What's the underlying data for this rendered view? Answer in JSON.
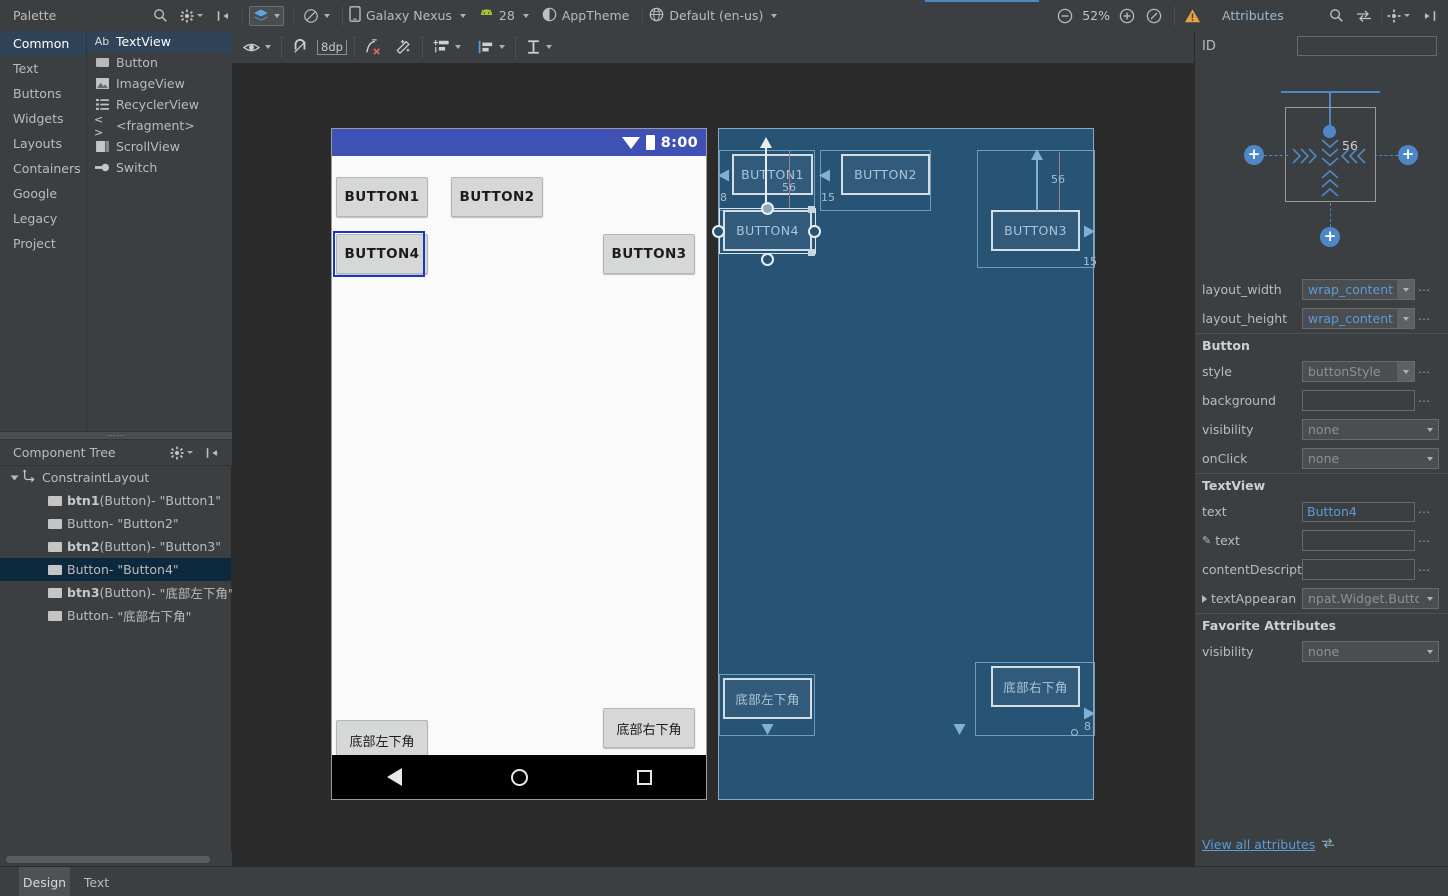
{
  "topbar": {
    "palette_title": "Palette",
    "search_icon": "search-icon",
    "gear_icon": "gear-icon",
    "collapse_icon": "collapse-panel-icon",
    "layers_icon": "design-surface-icon",
    "orientation_icon": "orientation-icon",
    "device_icon": "device-icon",
    "device": "Galaxy Nexus",
    "api_icon": "android-icon",
    "api_level": "28",
    "theme_icon": "theme-icon",
    "theme": "AppTheme",
    "locale_icon": "locale-icon",
    "locale": "Default (en-us)",
    "zoom_out_icon": "zoom-out-icon",
    "zoom_level": "52%",
    "zoom_in_icon": "zoom-in-icon",
    "zoom_fit_icon": "zoom-to-fit-icon",
    "warning_icon": "warning-icon",
    "attributes_title": "Attributes",
    "attr_search_icon": "search-icon",
    "attr_swap_icon": "swap-icon",
    "attr_gear_icon": "gear-icon",
    "attr_collapse_icon": "collapse-panel-icon"
  },
  "palette": {
    "categories": [
      {
        "label": "Common",
        "selected": true
      },
      {
        "label": "Text",
        "selected": false
      },
      {
        "label": "Buttons",
        "selected": false
      },
      {
        "label": "Widgets",
        "selected": false
      },
      {
        "label": "Layouts",
        "selected": false
      },
      {
        "label": "Containers",
        "selected": false
      },
      {
        "label": "Google",
        "selected": false
      },
      {
        "label": "Legacy",
        "selected": false
      },
      {
        "label": "Project",
        "selected": false
      }
    ],
    "items": [
      {
        "label": "TextView",
        "icon": "textview-icon",
        "glyph": "Ab",
        "selected": true
      },
      {
        "label": "Button",
        "icon": "button-icon",
        "glyph": "",
        "selected": false
      },
      {
        "label": "ImageView",
        "icon": "imageview-icon",
        "glyph": "",
        "selected": false
      },
      {
        "label": "RecyclerView",
        "icon": "recyclerview-icon",
        "glyph": "",
        "selected": false
      },
      {
        "label": "<fragment>",
        "icon": "fragment-icon",
        "glyph": "<>",
        "selected": false
      },
      {
        "label": "ScrollView",
        "icon": "scrollview-icon",
        "glyph": "",
        "selected": false
      },
      {
        "label": "Switch",
        "icon": "switch-icon",
        "glyph": "",
        "selected": false
      }
    ]
  },
  "component_tree": {
    "title": "Component Tree",
    "gear_icon": "gear-icon",
    "collapse_icon": "collapse-all-icon",
    "root": {
      "label": "ConstraintLayout",
      "icon": "constraintlayout-icon"
    },
    "rows": [
      {
        "id": "btn1",
        "type": " (Button)",
        "text": " - \"Button1\"",
        "bold": true,
        "selected": false
      },
      {
        "id": "Button",
        "type": "",
        "text": " - \"Button2\"",
        "bold": false,
        "selected": false
      },
      {
        "id": "btn2",
        "type": " (Button)",
        "text": " - \"Button3\"",
        "bold": true,
        "selected": false
      },
      {
        "id": "Button",
        "type": "",
        "text": " - \"Button4\"",
        "bold": false,
        "selected": true
      },
      {
        "id": "btn3",
        "type": " (Button)",
        "text": " - \"底部左下角\"",
        "bold": true,
        "selected": false
      },
      {
        "id": "Button",
        "type": "",
        "text": " - \"底部右下角\"",
        "bold": false,
        "selected": false
      }
    ]
  },
  "design_toolbar": {
    "eye_icon": "visibility-icon",
    "magnet_icon": "autoconnect-off-icon",
    "margin_value": "8dp",
    "clear_constraints_icon": "clear-constraints-icon",
    "infer_icon": "infer-constraints-icon",
    "guidelines_icon": "guidelines-icon",
    "align_icon": "align-icon",
    "baseline_icon": "baseline-margin-icon"
  },
  "preview": {
    "status_time": "8:00",
    "wifi_icon": "wifi-icon",
    "battery_icon": "battery-icon",
    "buttons": [
      {
        "name": "button1",
        "label": "BUTTON1",
        "selected": false
      },
      {
        "name": "button2",
        "label": "BUTTON2",
        "selected": false
      },
      {
        "name": "button3",
        "label": "BUTTON3",
        "selected": false
      },
      {
        "name": "button4",
        "label": "BUTTON4",
        "selected": true
      },
      {
        "name": "bottom-left-button",
        "label": "底部左下角",
        "selected": false
      },
      {
        "name": "bottom-right-button",
        "label": "底部右下角",
        "selected": false
      }
    ],
    "nav": {
      "back_icon": "nav-back-icon",
      "home_icon": "nav-home-icon",
      "recents_icon": "nav-recents-icon"
    }
  },
  "blueprint": {
    "buttons": [
      {
        "name": "button1",
        "label": "BUTTON1"
      },
      {
        "name": "button2",
        "label": "BUTTON2"
      },
      {
        "name": "button3",
        "label": "BUTTON3"
      },
      {
        "name": "button4",
        "label": "BUTTON4",
        "selected": true
      },
      {
        "name": "bottom-left-button",
        "label": "底部左下角"
      },
      {
        "name": "bottom-right-button",
        "label": "底部右下角"
      }
    ],
    "margins": [
      {
        "name": "margin-button1-left",
        "value": "8"
      },
      {
        "name": "margin-button1-top",
        "value": "56"
      },
      {
        "name": "margin-button2-left",
        "value": "15"
      },
      {
        "name": "margin-button3-top",
        "value": "56"
      },
      {
        "name": "margin-button3-right",
        "value": "15"
      },
      {
        "name": "margin-bottom-right-bottom",
        "value": "8"
      }
    ]
  },
  "attributes": {
    "id_label": "ID",
    "id_value": "",
    "constraint_widget": {
      "top_margin": "56",
      "plus_glyph": "+",
      "expand_right": "›››",
      "expand_left": "‹‹‹"
    },
    "rows": [
      {
        "label": "layout_width",
        "value": "wrap_content",
        "kind": "combo",
        "muted": false,
        "dots": true
      },
      {
        "label": "layout_height",
        "value": "wrap_content",
        "kind": "combo",
        "muted": false,
        "dots": true
      }
    ],
    "sections": [
      {
        "title": "Button",
        "rows": [
          {
            "label": "style",
            "value": "buttonStyle",
            "kind": "combo",
            "muted": true,
            "dots": true
          },
          {
            "label": "background",
            "value": "",
            "kind": "field",
            "muted": false,
            "dots": true
          },
          {
            "label": "visibility",
            "value": "none",
            "kind": "combo-wide",
            "muted": true,
            "dots": false
          },
          {
            "label": "onClick",
            "value": "none",
            "kind": "combo-wide",
            "muted": true,
            "dots": false
          }
        ]
      },
      {
        "title": "TextView",
        "rows": [
          {
            "label": "text",
            "value": "Button4",
            "kind": "field-value",
            "muted": false,
            "dots": true
          },
          {
            "label": "text",
            "value": "",
            "kind": "field",
            "muted": false,
            "dots": true,
            "prefix": "pencil"
          },
          {
            "label": "contentDescripti",
            "value": "",
            "kind": "field",
            "muted": false,
            "dots": true
          },
          {
            "label": "textAppearan",
            "value": "npat.Widget.Button",
            "kind": "combo-wide",
            "muted": true,
            "dots": false,
            "prefix": "expander"
          }
        ]
      },
      {
        "title": "Favorite Attributes",
        "rows": [
          {
            "label": "visibility",
            "value": "none",
            "kind": "combo-wide",
            "muted": true,
            "dots": false
          }
        ]
      }
    ],
    "view_all": "View all attributes",
    "view_all_icon": "swap-icon"
  },
  "bottom_tabs": [
    {
      "label": "Design",
      "active": true
    },
    {
      "label": "Text",
      "active": false
    }
  ],
  "colors": {
    "accent": "#4e87c6",
    "panel_bg": "#3c3f41",
    "canvas_bg": "#2b2b2b",
    "selection": "#0d293e",
    "blueprint_bg": "#275374",
    "status_bar": "#3f51b5",
    "link": "#5b9bd8"
  }
}
